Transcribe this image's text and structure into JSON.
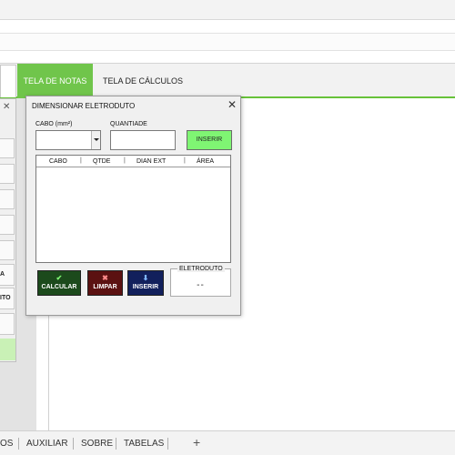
{
  "sheet_tabs": {
    "notas": "TELA DE NOTAS",
    "calculos": "TELA DE CÁLCULOS"
  },
  "background_panel": {
    "close": "✕",
    "text1": "A",
    "text2": "ITO"
  },
  "dialog": {
    "title": "DIMENSIONAR ELETRODUTO",
    "close": "✕",
    "cabo_label": "CABO (mm²)",
    "quantidade_label": "QUANTIADE",
    "cabo_value": "",
    "quantidade_value": "",
    "inserir_top": "INSERIR",
    "list_columns": [
      "CABO",
      "QTDE",
      "DIAN EXT",
      "ÁREA"
    ],
    "list_sep": "|",
    "buttons": {
      "calcular": "CALCULAR",
      "limpar": "LIMPAR",
      "inserir": "INSERIR"
    },
    "icons": {
      "calcular": "✔",
      "limpar": "✖",
      "inserir": "⬇"
    },
    "eletroduto_label": "ELETRODUTO",
    "eletroduto_value": "--"
  },
  "bottom_tabs": [
    "OS",
    "AUXILIAR",
    "SOBRE",
    "TABELAS"
  ],
  "bottom_add": "+",
  "colors": {
    "accent_green": "#70c54b",
    "inserir_green": "#7ff573",
    "calcular_bg": "#1c4a1c",
    "limpar_bg": "#5b1111",
    "inserir_bg": "#12205c"
  }
}
